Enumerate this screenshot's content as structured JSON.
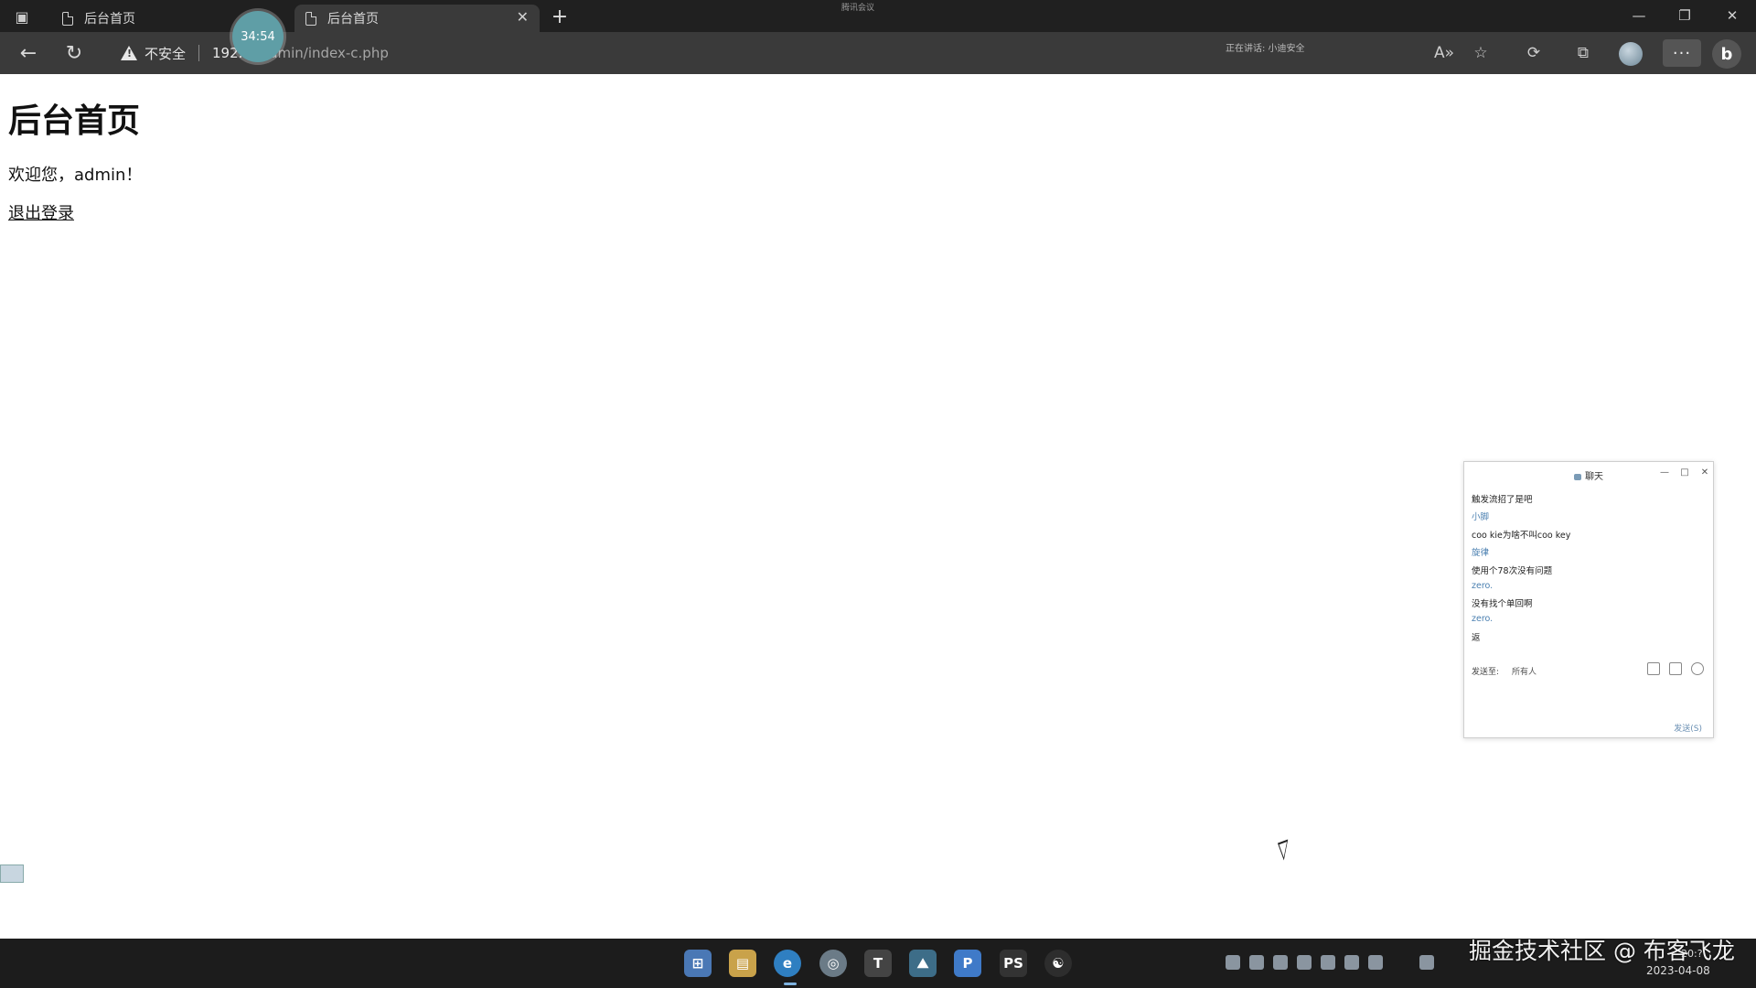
{
  "browser": {
    "tabs": [
      {
        "label": "后台首页",
        "active": false
      },
      {
        "label": "后台首页",
        "active": true
      }
    ],
    "timer": "34:54",
    "meeting_indicator": "腾讯会议",
    "security_label": "不安全",
    "url_host": "192.",
    "url_path": ".7/admin/index-c.php",
    "speaking_label": "正在讲话: 小迪安全"
  },
  "page": {
    "title": "后台首页",
    "welcome": "欢迎您，admin！",
    "logout_link": "退出登录"
  },
  "chat": {
    "title": "聊天",
    "messages": [
      {
        "text": "触发流招了是吧",
        "kind": "msg"
      },
      {
        "text": "小脚",
        "kind": "name"
      },
      {
        "text": "coo kie为啥不叫coo key",
        "kind": "msg"
      },
      {
        "text": "旋律",
        "kind": "name"
      },
      {
        "text": "使用个78次没有问题",
        "kind": "msg"
      },
      {
        "text": "zero.",
        "kind": "name"
      },
      {
        "text": "没有找个单回啊",
        "kind": "msg"
      },
      {
        "text": "zero.",
        "kind": "name"
      },
      {
        "text": "返",
        "kind": "msg"
      }
    ],
    "send_to_label": "发送至:",
    "send_to_value": "所有人",
    "send_button": "发送(S)"
  },
  "taskbar": {
    "watermark": "掘金技术社区 @ 布客飞龙",
    "time": "20:?",
    "date": "2023-04-08",
    "lang": "英"
  },
  "colors": {
    "tab_bar": "#202020",
    "toolbar": "#3a3a3a",
    "page_bg": "#ffffff",
    "timer_bubble": "#5f9ea6"
  }
}
